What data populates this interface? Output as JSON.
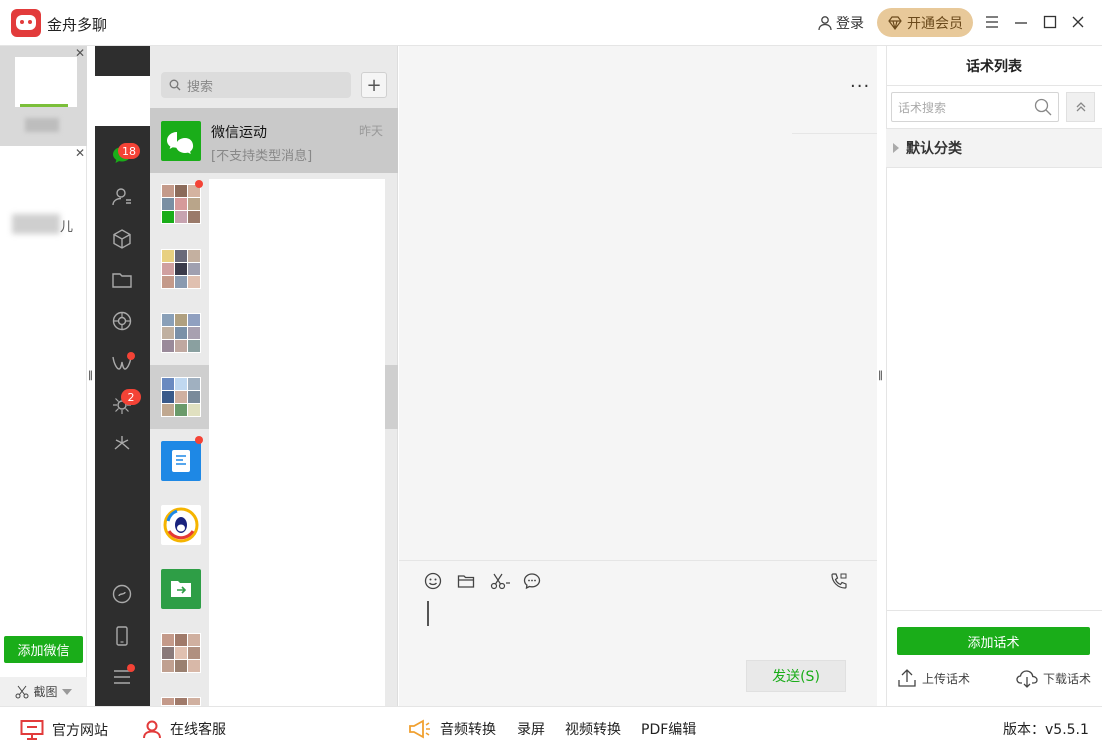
{
  "app": {
    "title": "金舟多聊",
    "login_label": "登录",
    "vip_label": "开通会员",
    "accent_color": "#1aad19",
    "brand_color": "#e23b3b"
  },
  "accounts": {
    "second_suffix": "儿",
    "add_wechat_label": "添加微信",
    "screenshot_label": "截图"
  },
  "wechat_sidebar": {
    "chats_badge": "18",
    "moments_badge": "2"
  },
  "chat_list": {
    "search_placeholder": "搜索",
    "add_label": "+",
    "first_chat": {
      "name": "微信运动",
      "preview": "[不支持类型消息]",
      "time": "昨天"
    }
  },
  "chat": {
    "more_label": "···",
    "send_label": "发送(S)"
  },
  "script_panel": {
    "title": "话术列表",
    "search_placeholder": "话术搜索",
    "category": "默认分类",
    "add_label": "添加话术",
    "upload_label": "上传话术",
    "download_label": "下载话术"
  },
  "footer": {
    "website_label": "官方网站",
    "support_label": "在线客服",
    "audio_label": "音频转换",
    "record_label": "录屏",
    "video_label": "视频转换",
    "pdf_label": "PDF编辑",
    "version_label": "版本：v5.5.1"
  }
}
